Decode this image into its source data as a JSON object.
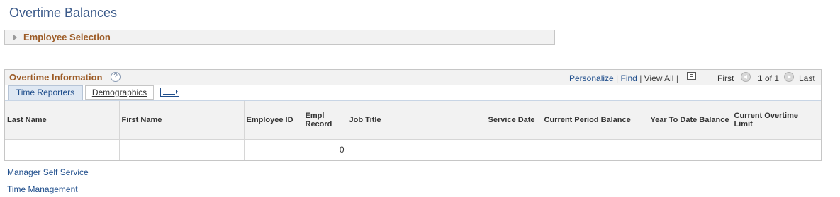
{
  "page": {
    "title": "Overtime Balances"
  },
  "employee_selection": {
    "label": "Employee Selection"
  },
  "grid": {
    "title": "Overtime Information",
    "help": "?",
    "nav": {
      "personalize": "Personalize",
      "find": "Find",
      "view_all": "View All",
      "first": "First",
      "range": "1 of 1",
      "last": "Last",
      "sep": "|"
    },
    "tabs": [
      {
        "label": "Time Reporters"
      },
      {
        "label": "Demographics"
      }
    ],
    "columns": [
      "Last Name",
      "First Name",
      "Employee ID",
      "Empl Record",
      "Job Title",
      "Service Date",
      "Current Period Balance",
      "Year To Date Balance",
      "Current Overtime Limit"
    ],
    "rows": [
      [
        "",
        "",
        "",
        "0",
        "",
        "",
        "",
        "",
        ""
      ]
    ]
  },
  "footer_links": [
    {
      "label": "Manager Self Service"
    },
    {
      "label": "Time Management"
    }
  ]
}
